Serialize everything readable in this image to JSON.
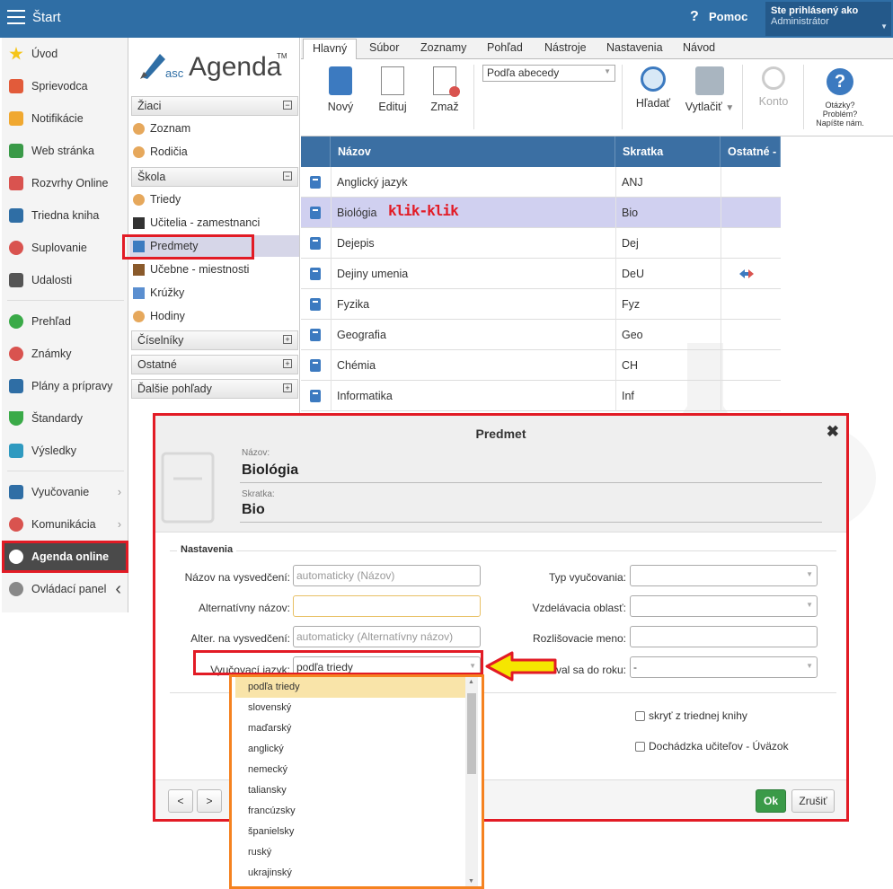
{
  "topbar": {
    "title": "Štart",
    "help": "?",
    "help_label": "Pomoc",
    "user_line1": "Ste prihlásený ako",
    "user_line2": "Administrátor"
  },
  "leftnav": {
    "items": [
      "Úvod",
      "Sprievodca",
      "Notifikácie",
      "Web stránka",
      "Rozvrhy Online",
      "Triedna kniha",
      "Suplovanie",
      "Udalosti",
      "Prehľad",
      "Známky",
      "Plány a prípravy",
      "Štandardy",
      "Výsledky",
      "Vyučovanie",
      "Komunikácia",
      "Agenda online",
      "Ovládací panel"
    ]
  },
  "tree": {
    "logo_prefix": "asc",
    "logo_name": "Agenda",
    "logo_tm": "TM",
    "sections": [
      "Žiaci",
      "Škola",
      "Číselníky",
      "Ostatné",
      "Ďalšie pohľady"
    ],
    "ziaci_items": [
      "Zoznam",
      "Rodičia"
    ],
    "skola_items": [
      "Triedy",
      "Učitelia - zamestnanci",
      "Predmety",
      "Učebne - miestnosti",
      "Krúžky",
      "Hodiny"
    ]
  },
  "tabs": [
    "Hlavný",
    "Súbor",
    "Zoznamy",
    "Pohľad",
    "Nástroje",
    "Nastavenia",
    "Návod"
  ],
  "ribbon": {
    "novy": "Nový",
    "edituj": "Edituj",
    "zmaz": "Zmaž",
    "sort": "Podľa abecedy",
    "hladat": "Hľadať",
    "vytlacit": "Vytlačiť",
    "konto": "Konto",
    "otazky": "Otázky? Problém? Napíšte nám."
  },
  "grid": {
    "headers": [
      "Názov",
      "Skratka",
      "Ostatné - I"
    ],
    "rows": [
      {
        "name": "Anglický jazyk",
        "abbr": "ANJ"
      },
      {
        "name": "Biológia",
        "abbr": "Bio"
      },
      {
        "name": "Dejepis",
        "abbr": "Dej"
      },
      {
        "name": "Dejiny umenia",
        "abbr": "DeU"
      },
      {
        "name": "Fyzika",
        "abbr": "Fyz"
      },
      {
        "name": "Geografia",
        "abbr": "Geo"
      },
      {
        "name": "Chémia",
        "abbr": "CH"
      },
      {
        "name": "Informatika",
        "abbr": "Inf"
      }
    ],
    "annotation": "klik-klik"
  },
  "dialog": {
    "title": "Predmet",
    "nazov_label": "Názov:",
    "nazov_value": "Biológia",
    "skratka_label": "Skratka:",
    "skratka_value": "Bio",
    "section": "Nastavenia",
    "fields": {
      "nazov_vysv": "Názov na vysvedčení:",
      "nazov_vysv_ph": "automaticky (Názov)",
      "alt_nazov": "Alternatívny názov:",
      "alter_vysv": "Alter. na vysvedčení:",
      "alter_vysv_ph": "automaticky (Alternatívny názov)",
      "jazyk": "Vyučovací jazyk:",
      "jazyk_value": "podľa triedy",
      "typ": "Typ vyučovania:",
      "oblast": "Vzdelávacia oblasť:",
      "rozlis": "Rozlišovacie meno:",
      "dorok": "val sa do roku:",
      "dorok_value": "-"
    },
    "checks": [
      "skryť z triednej knihy",
      "Dochádzka učiteľov - Úväzok"
    ],
    "prev": "<",
    "next": ">",
    "ok": "Ok",
    "cancel": "Zrušiť"
  },
  "dropdown": {
    "options": [
      "podľa triedy",
      "slovenský",
      "maďarský",
      "anglický",
      "nemecký",
      "taliansky",
      "francúzsky",
      "španielsky",
      "ruský",
      "ukrajinský"
    ]
  },
  "colors": {
    "header_blue": "#2f6ea5",
    "highlight_red": "#e21b25",
    "arrow_yellow": "#f5e600",
    "ok_green": "#3a9a48"
  }
}
